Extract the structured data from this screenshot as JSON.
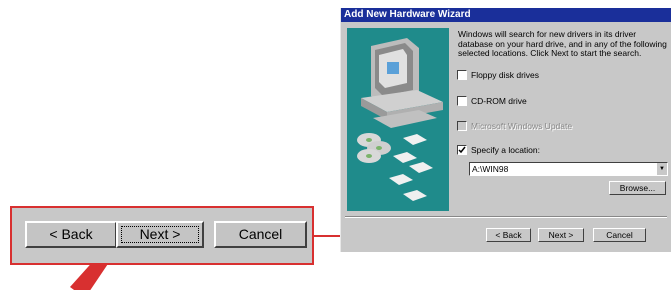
{
  "zoom": {
    "back_label": "< Back",
    "next_label": "Next >",
    "cancel_label": "Cancel"
  },
  "dialog": {
    "title": "Add New Hardware Wizard",
    "description": "Windows will search for new drivers in its driver database on your hard drive, and in any of the following selected locations. Click Next to start the search.",
    "options": [
      {
        "label": "Floppy disk drives",
        "checked": false,
        "enabled": true
      },
      {
        "label": "CD-ROM drive",
        "checked": false,
        "enabled": true
      },
      {
        "label": "Microsoft Windows Update",
        "checked": false,
        "enabled": false
      },
      {
        "label": "Specify a location:",
        "checked": true,
        "enabled": true
      }
    ],
    "location_value": "A:\\WIN98",
    "browse_label": "Browse...",
    "back_label": "< Back",
    "next_label": "Next >",
    "cancel_label": "Cancel"
  },
  "colors": {
    "callout_red": "#d83030",
    "titlebar": "#1a2f9a",
    "illustration_bg": "#1f8b8b"
  }
}
